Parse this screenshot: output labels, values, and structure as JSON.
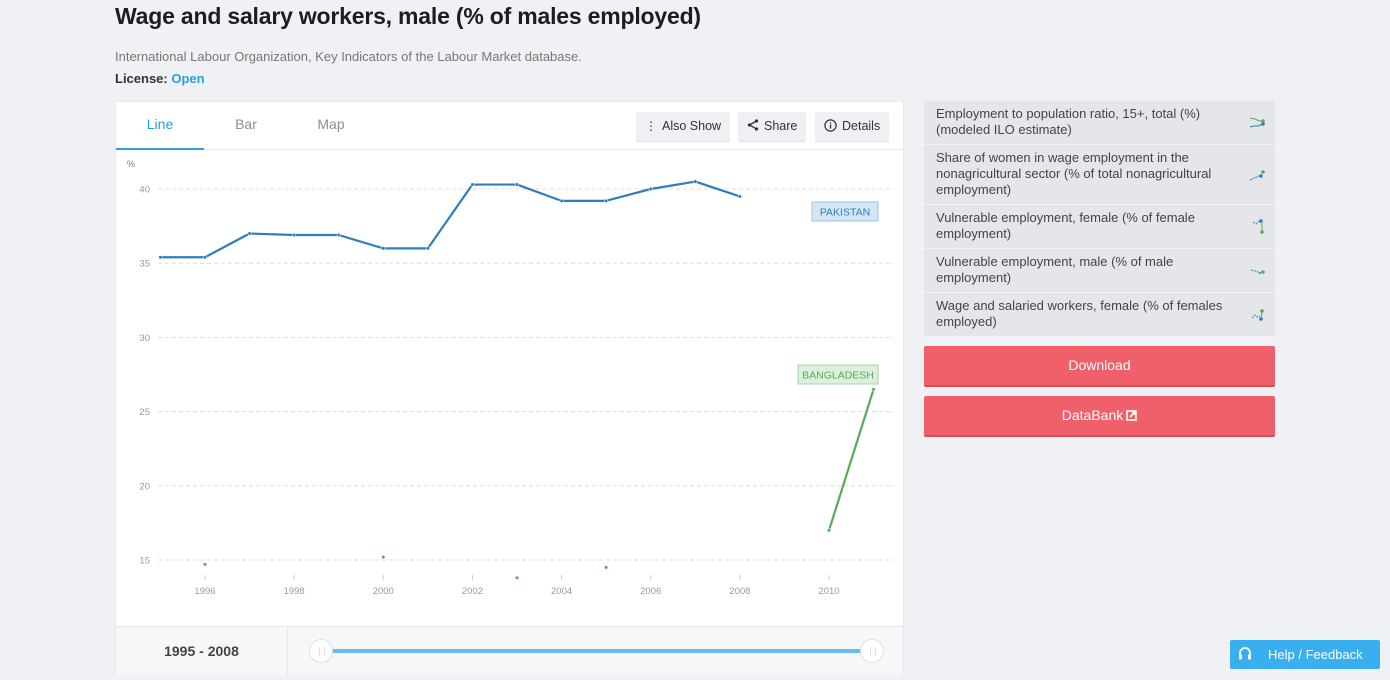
{
  "header": {
    "title": "Wage and salary workers, male (% of males employed)",
    "source": "International Labour Organization, Key Indicators of the Labour Market database.",
    "license_label": "License:",
    "license_value": "Open"
  },
  "tabs": [
    {
      "label": "Line",
      "active": true
    },
    {
      "label": "Bar",
      "active": false
    },
    {
      "label": "Map",
      "active": false
    }
  ],
  "toolbar": {
    "also_show": "Also Show",
    "share": "Share",
    "details": "Details"
  },
  "range": {
    "label_start": "1995",
    "label_sep": " - ",
    "label_end": "2008",
    "start_fraction": 0.0,
    "end_fraction": 1.0
  },
  "related": [
    {
      "label": "Employment to population ratio, 15+, total (%) (modeled ILO estimate)",
      "icon": "sparkline-icon"
    },
    {
      "label": "Share of women in wage employment in the nonagricultural sector (% of total nonagricultural employment)",
      "icon": "sparkline-icon"
    },
    {
      "label": "Vulnerable employment, female (% of female employment)",
      "icon": "sparkline-icon"
    },
    {
      "label": "Vulnerable employment, male (% of male employment)",
      "icon": "sparkline-icon"
    },
    {
      "label": "Wage and salaried workers, female (% of females employed)",
      "icon": "sparkline-icon"
    }
  ],
  "actions": {
    "download": "Download",
    "databank": "DataBank"
  },
  "help": {
    "label": "Help / Feedback"
  },
  "colors": {
    "pakistan": "#2f7ebc",
    "bangladesh": "#5aaa5a",
    "accent": "#2a9fd8",
    "red_button": "#f0606a",
    "help_button": "#3aaff0"
  },
  "chart_data": {
    "type": "line",
    "title": "Wage and salary workers, male (% of males employed)",
    "xlabel": "",
    "ylabel": "%",
    "xlim": [
      1995,
      2011
    ],
    "ylim": [
      14,
      41.5
    ],
    "x_ticks": [
      1996,
      1998,
      2000,
      2002,
      2004,
      2006,
      2008,
      2010
    ],
    "y_ticks": [
      15,
      20,
      25,
      30,
      35,
      40
    ],
    "grid": true,
    "series": [
      {
        "name": "PAKISTAN",
        "color": "#2f7ebc",
        "x": [
          1995,
          1996,
          1997,
          1998,
          1999,
          2000,
          2001,
          2002,
          2003,
          2004,
          2005,
          2006,
          2007,
          2008
        ],
        "values": [
          35.4,
          35.4,
          37.0,
          36.9,
          36.9,
          36.0,
          36.0,
          40.3,
          40.3,
          39.2,
          39.2,
          40.0,
          40.5,
          39.5
        ]
      },
      {
        "name": "BANGLADESH",
        "color": "#5aaa5a",
        "x": [
          1996,
          2000,
          2003,
          2005,
          2010,
          2011
        ],
        "values": [
          14.7,
          15.2,
          13.8,
          14.5,
          17.0,
          26.5
        ]
      }
    ]
  }
}
